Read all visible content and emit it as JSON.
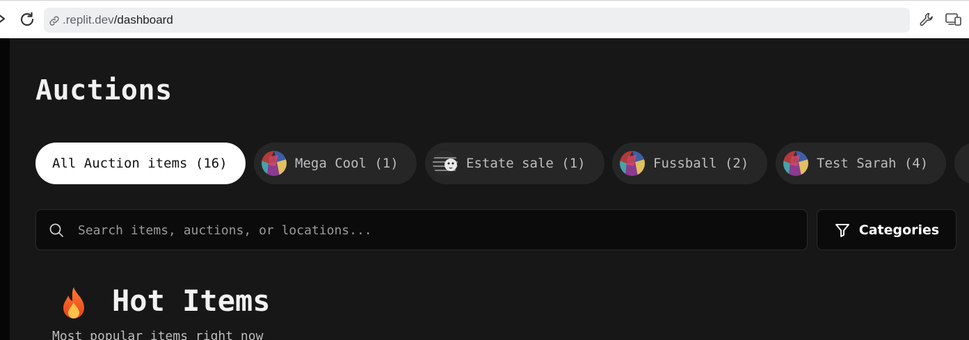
{
  "browser": {
    "url_host": ".replit.dev",
    "url_path": "/dashboard",
    "icons": [
      "forward-icon",
      "reload-icon",
      "link-icon",
      "wrench-icon",
      "devices-icon"
    ]
  },
  "page": {
    "title": "Auctions"
  },
  "filters": [
    {
      "label": "All Auction items (16)",
      "active": true
    },
    {
      "label": "Mega Cool (1)",
      "active": false,
      "avatar": "mosaic"
    },
    {
      "label": "Estate sale (1)",
      "active": false,
      "avatar": "dog"
    },
    {
      "label": "Fussball (2)",
      "active": false,
      "avatar": "mosaic"
    },
    {
      "label": "Test Sarah (4)",
      "active": false,
      "avatar": "mosaic"
    }
  ],
  "search": {
    "placeholder": "Search items, auctions, or locations...",
    "value": ""
  },
  "categories_button": {
    "label": "Categories",
    "icon": "filter-icon"
  },
  "hot_section": {
    "icon": "fire-icon",
    "title": "Hot Items",
    "subtitle": "Most popular items right now"
  },
  "colors": {
    "background": "#171717",
    "pill": "#262626",
    "pill_active": "#ffffff",
    "input_bg": "#0b0b0c"
  }
}
